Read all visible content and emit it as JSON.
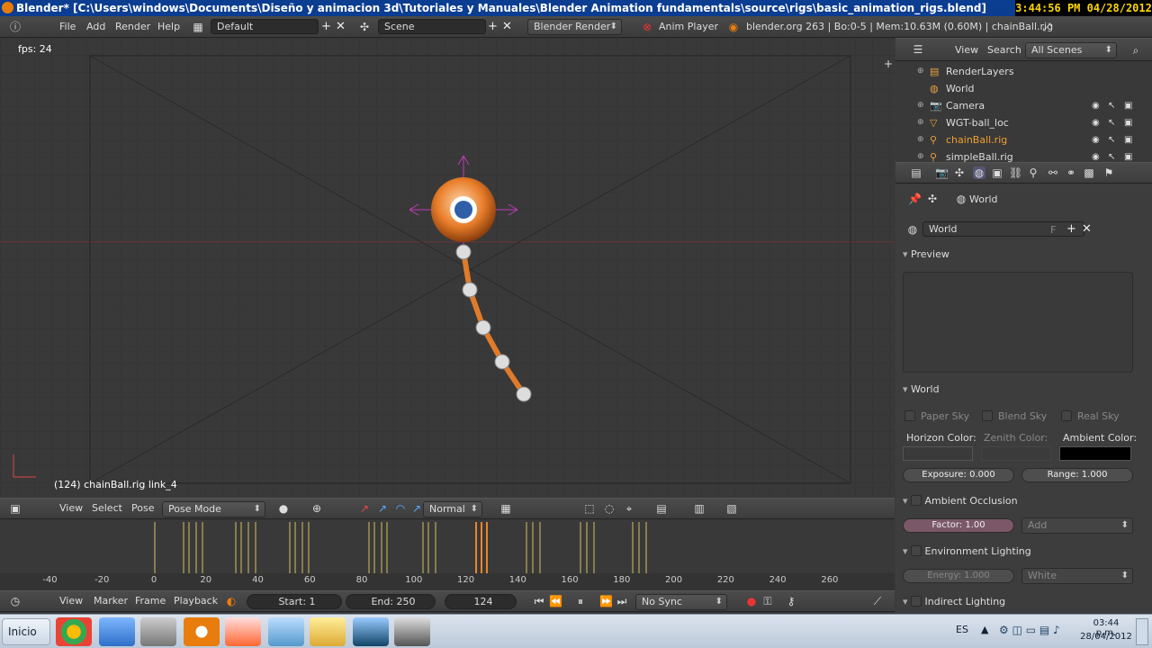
{
  "window": {
    "title": "Blender* [C:\\Users\\windows\\Documents\\Diseño y animacion 3d\\Tutoriales y Manuales\\Blender Animation fundamentals\\source\\rigs\\basic_animation_rigs.blend]",
    "clock": "3:44:56 PM 04/28/2012"
  },
  "menu": {
    "file": "File",
    "add": "Add",
    "render": "Render",
    "help": "Help"
  },
  "screen_layout": "Default",
  "scene": "Scene",
  "render_engine": "Blender Render",
  "anim_player": "Anim Player",
  "stats": "blender.org 263 | Bo:0-5 | Mem:10.63M (0.60M) | chainBall.rig",
  "viewport": {
    "fps": "fps: 24",
    "object_info": "(124) chainBall.rig link_4"
  },
  "view3d_header": {
    "view": "View",
    "select": "Select",
    "pose": "Pose",
    "mode": "Pose Mode",
    "pivot": "Normal"
  },
  "timeline_ruler": [
    "-40",
    "-20",
    "0",
    "20",
    "40",
    "60",
    "80",
    "100",
    "120",
    "140",
    "160",
    "180",
    "200",
    "220",
    "240",
    "260"
  ],
  "timeline_header": {
    "view": "View",
    "marker": "Marker",
    "frame": "Frame",
    "playback": "Playback",
    "start": "Start: 1",
    "end": "End: 250",
    "current": "124",
    "sync": "No Sync"
  },
  "outliner": {
    "view": "View",
    "search": "Search",
    "filter": "All Scenes",
    "items": [
      {
        "label": "RenderLayers",
        "icon": "renderlayers-icon"
      },
      {
        "label": "World",
        "icon": "world-icon"
      },
      {
        "label": "Camera",
        "icon": "camera-icon"
      },
      {
        "label": "WGT-ball_loc",
        "icon": "mesh-icon"
      },
      {
        "label": "chainBall.rig",
        "icon": "armature-icon"
      },
      {
        "label": "simpleBall.rig",
        "icon": "armature-icon"
      }
    ]
  },
  "properties": {
    "context": "World",
    "world_name": "World",
    "fake_user": "F",
    "preview_label": "Preview",
    "world_label": "World",
    "paper_sky": "Paper Sky",
    "blend_sky": "Blend Sky",
    "real_sky": "Real Sky",
    "horizon_color": "Horizon Color:",
    "zenith_color": "Zenith Color:",
    "ambient_color": "Ambient Color:",
    "exposure": "Exposure: 0.000",
    "range": "Range: 1.000",
    "ambient_occlusion": "Ambient Occlusion",
    "factor": "Factor: 1.00",
    "blend_mode": "Add",
    "environment_lighting": "Environment Lighting",
    "energy": "Energy: 1.000",
    "env_color": "White",
    "indirect_lighting": "Indirect Lighting"
  },
  "taskbar": {
    "start": "Inicio",
    "lang": "ES",
    "time": "03:44 p.m.",
    "date": "28/04/2012"
  },
  "colors": {
    "title_bar": "#0b3d91",
    "clock_text": "#ffd700",
    "accent": "#e87d0d",
    "grid": "#2f2f2f",
    "bone": "#e07b2a"
  }
}
